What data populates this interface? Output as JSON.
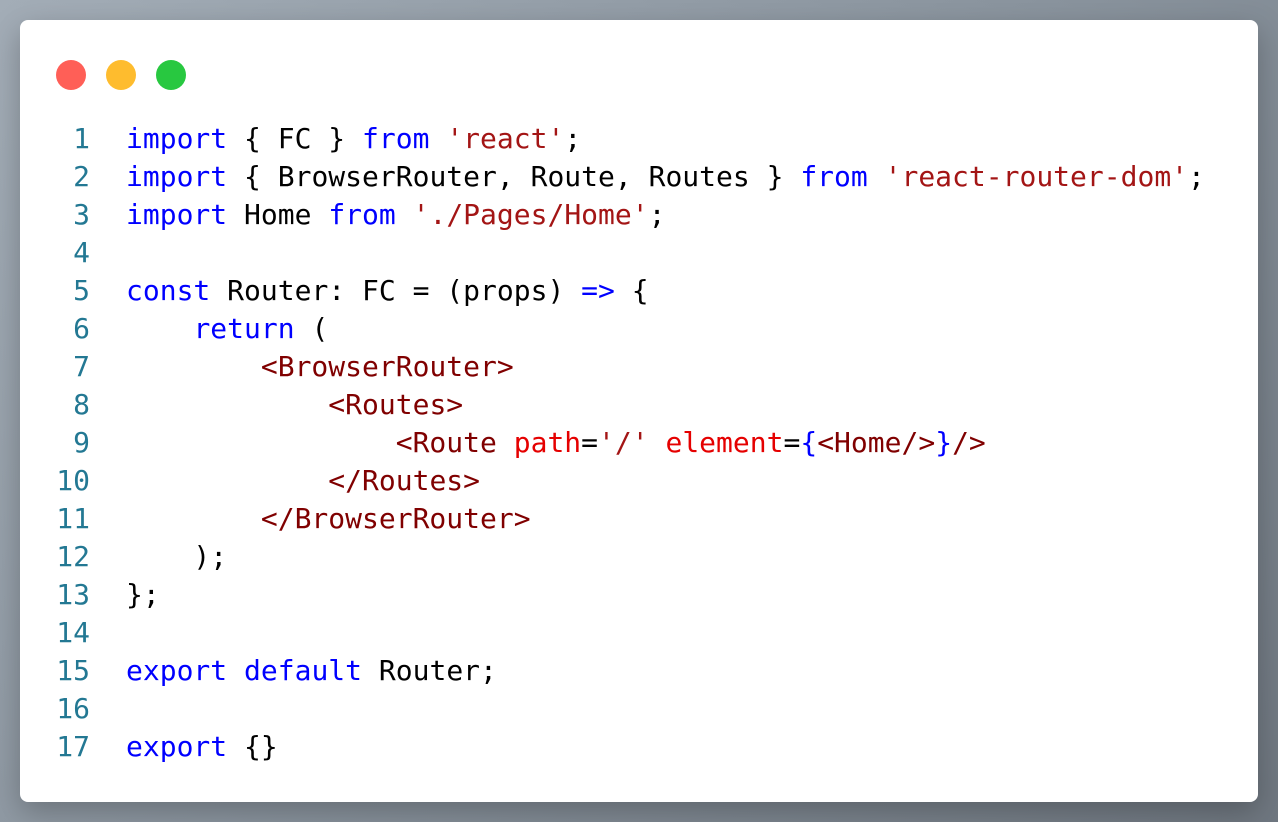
{
  "window": {
    "controls": [
      {
        "name": "close",
        "color": "#ff5f57"
      },
      {
        "name": "minimize",
        "color": "#febc2e"
      },
      {
        "name": "maximize",
        "color": "#28c840"
      }
    ]
  },
  "code": {
    "language": "tsx",
    "lines": [
      [
        [
          "kw",
          "import"
        ],
        [
          "txt",
          " { FC } "
        ],
        [
          "kw",
          "from"
        ],
        [
          "txt",
          " "
        ],
        [
          "str",
          "'react'"
        ],
        [
          "txt",
          ";"
        ]
      ],
      [
        [
          "kw",
          "import"
        ],
        [
          "txt",
          " { BrowserRouter, Route, Routes } "
        ],
        [
          "kw",
          "from"
        ],
        [
          "txt",
          " "
        ],
        [
          "str",
          "'react-router-dom'"
        ],
        [
          "txt",
          ";"
        ]
      ],
      [
        [
          "kw",
          "import"
        ],
        [
          "txt",
          " Home "
        ],
        [
          "kw",
          "from"
        ],
        [
          "txt",
          " "
        ],
        [
          "str",
          "'./Pages/Home'"
        ],
        [
          "txt",
          ";"
        ]
      ],
      [],
      [
        [
          "kw",
          "const"
        ],
        [
          "txt",
          " Router: FC = (props) "
        ],
        [
          "kw",
          "=>"
        ],
        [
          "txt",
          " {"
        ]
      ],
      [
        [
          "txt",
          "    "
        ],
        [
          "kw",
          "return"
        ],
        [
          "txt",
          " ("
        ]
      ],
      [
        [
          "txt",
          "        "
        ],
        [
          "tag",
          "<BrowserRouter>"
        ]
      ],
      [
        [
          "txt",
          "            "
        ],
        [
          "tag",
          "<Routes>"
        ]
      ],
      [
        [
          "txt",
          "                "
        ],
        [
          "tag",
          "<Route"
        ],
        [
          "txt",
          " "
        ],
        [
          "attr",
          "path"
        ],
        [
          "txt",
          "="
        ],
        [
          "str",
          "'/'"
        ],
        [
          "txt",
          " "
        ],
        [
          "attr",
          "element"
        ],
        [
          "txt",
          "="
        ],
        [
          "kw",
          "{"
        ],
        [
          "tag",
          "<Home/>"
        ],
        [
          "kw",
          "}"
        ],
        [
          "tag",
          "/>"
        ]
      ],
      [
        [
          "txt",
          "            "
        ],
        [
          "tag",
          "</Routes>"
        ]
      ],
      [
        [
          "txt",
          "        "
        ],
        [
          "tag",
          "</BrowserRouter>"
        ]
      ],
      [
        [
          "txt",
          "    );"
        ]
      ],
      [
        [
          "txt",
          "};"
        ]
      ],
      [],
      [
        [
          "kw",
          "export"
        ],
        [
          "txt",
          " "
        ],
        [
          "kw",
          "default"
        ],
        [
          "txt",
          " Router;"
        ]
      ],
      [],
      [
        [
          "kw",
          "export"
        ],
        [
          "txt",
          " {}"
        ]
      ]
    ]
  }
}
